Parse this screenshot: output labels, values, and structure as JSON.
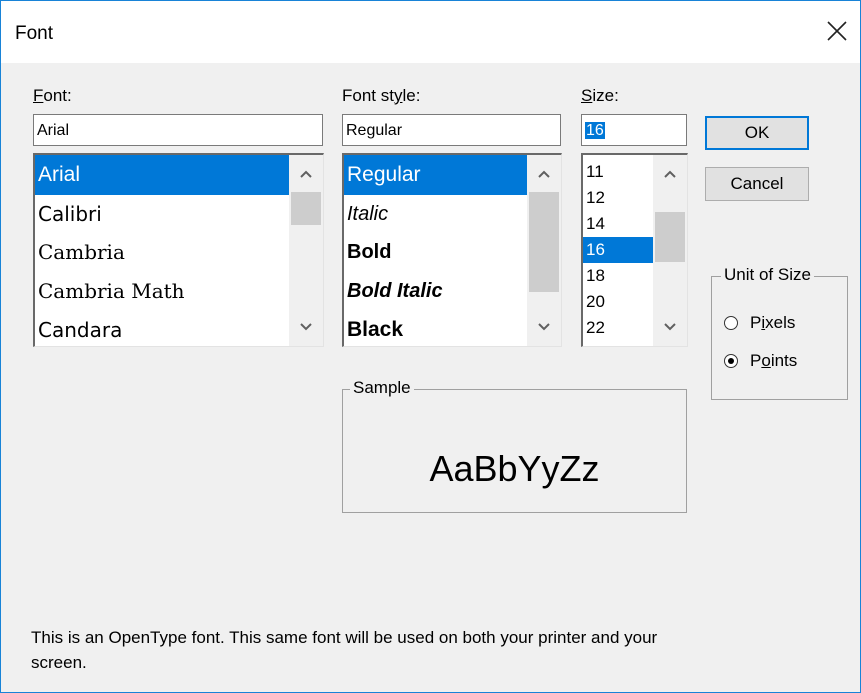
{
  "window": {
    "title": "Font",
    "close_icon": "close-icon"
  },
  "font": {
    "label_accel": "F",
    "label_rest": "ont:",
    "value": "Arial",
    "items": [
      "Arial",
      "Calibri",
      "Cambria",
      "Cambria Math",
      "Candara"
    ],
    "selected_index": 0
  },
  "style": {
    "label_pre": "Font st",
    "label_accel": "y",
    "label_post": "le:",
    "value": "Regular",
    "items": [
      "Regular",
      "Italic",
      "Bold",
      "Bold Italic",
      "Black"
    ],
    "selected_index": 0
  },
  "size": {
    "label_accel": "S",
    "label_rest": "ize:",
    "value": "16",
    "items": [
      "11",
      "12",
      "14",
      "16",
      "18",
      "20",
      "22"
    ],
    "selected_index": 3
  },
  "buttons": {
    "ok": "OK",
    "cancel": "Cancel"
  },
  "unit": {
    "legend": "Unit of Size",
    "pixels_pre": "P",
    "pixels_accel": "i",
    "pixels_post": "xels",
    "points_pre": "P",
    "points_accel": "o",
    "points_post": "ints",
    "selected": "Points"
  },
  "sample": {
    "legend": "Sample",
    "text": "AaBbYyZz"
  },
  "description": "This is an OpenType font. This same font will be used on both your printer and your screen.",
  "colors": {
    "accent": "#0078d7",
    "window_border": "#1883d7",
    "face": "#f0f0f0"
  }
}
